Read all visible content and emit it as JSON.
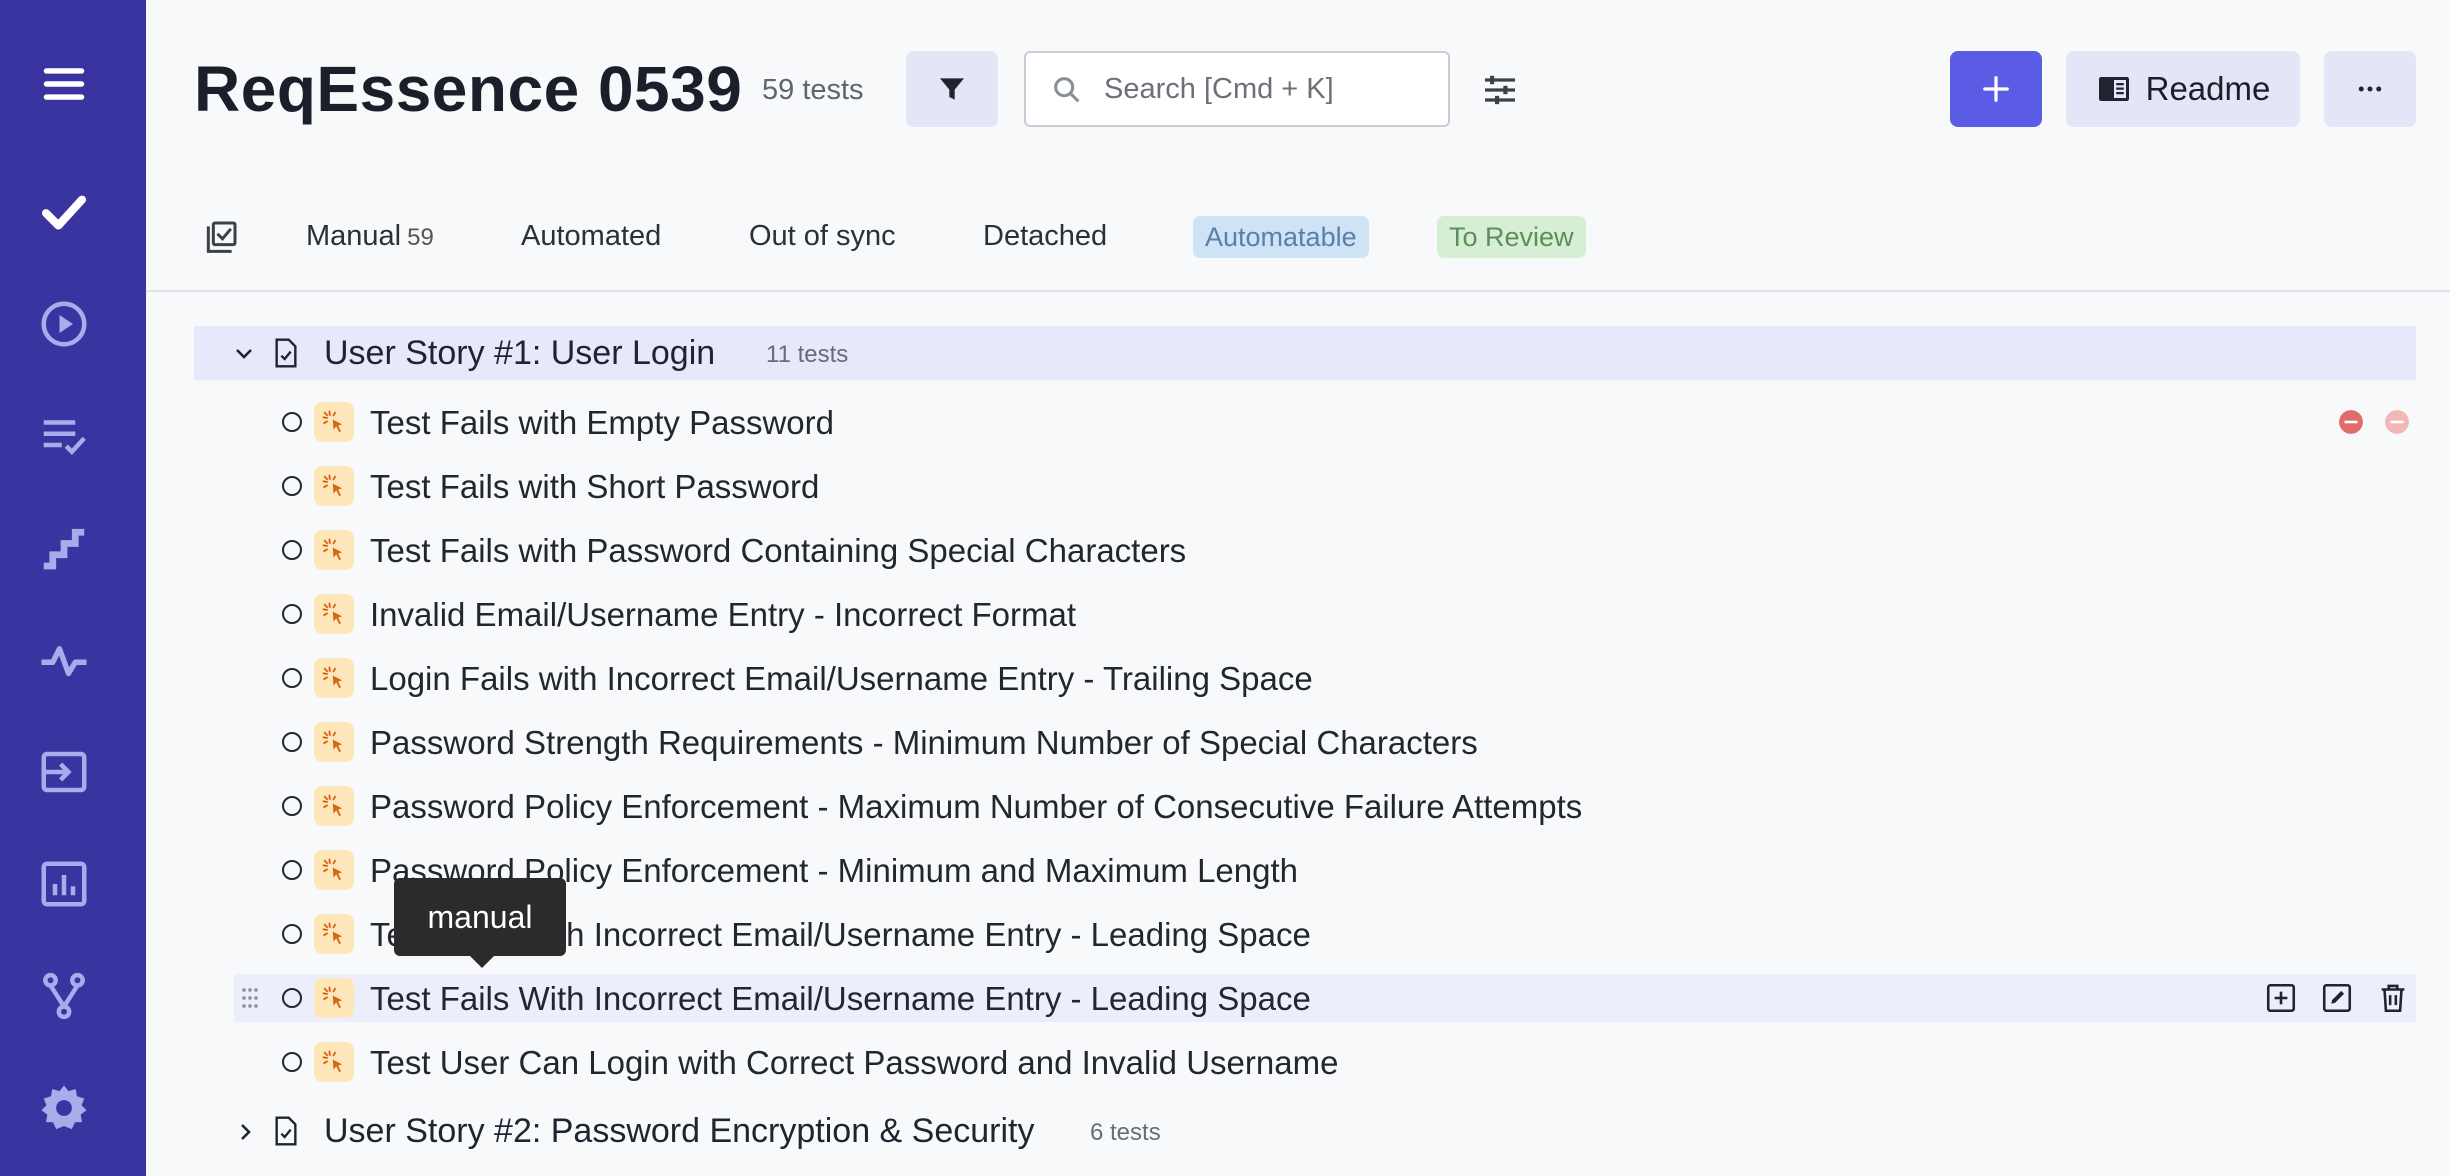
{
  "sidebar": {
    "bg": "#3a34a0",
    "items": [
      {
        "name": "menu-icon"
      },
      {
        "name": "checkmark-icon"
      },
      {
        "name": "play-icon"
      },
      {
        "name": "checklist-icon"
      },
      {
        "name": "steps-icon"
      },
      {
        "name": "pulse-icon"
      },
      {
        "name": "import-icon"
      },
      {
        "name": "analytics-icon"
      },
      {
        "name": "branch-icon"
      },
      {
        "name": "settings-icon"
      }
    ]
  },
  "header": {
    "title": "ReqEssence 0539",
    "tests_count": "59 tests",
    "search_placeholder": "Search [Cmd + K]",
    "readme_label": "Readme",
    "accent": "#5b5ce6"
  },
  "tabs": {
    "manual_label": "Manual",
    "manual_count": "59",
    "automated_label": "Automated",
    "out_of_sync_label": "Out of sync",
    "detached_label": "Detached",
    "automatable_label": "Automatable",
    "to_review_label": "To Review"
  },
  "suites": [
    {
      "title": "User Story #1: User Login",
      "count": "11 tests",
      "tests": [
        "Test Fails with Empty Password",
        "Test Fails with Short Password",
        "Test Fails with Password Containing Special Characters",
        "Invalid Email/Username Entry - Incorrect Format",
        "Login Fails with Incorrect Email/Username Entry - Trailing Space",
        "Password Strength Requirements - Minimum Number of Special Characters",
        "Password Policy Enforcement - Maximum Number of Consecutive Failure Attempts",
        "Password Policy Enforcement - Minimum and Maximum Length",
        "Test Fails With Incorrect Email/Username Entry - Leading Space",
        "Test Fails With Incorrect Email/Username Entry - Leading Space",
        "Test User Can Login with Correct Password and Invalid Username"
      ]
    },
    {
      "title": "User Story #2: Password Encryption & Security",
      "count": "6 tests"
    }
  ],
  "tooltip": {
    "text": "manual"
  }
}
